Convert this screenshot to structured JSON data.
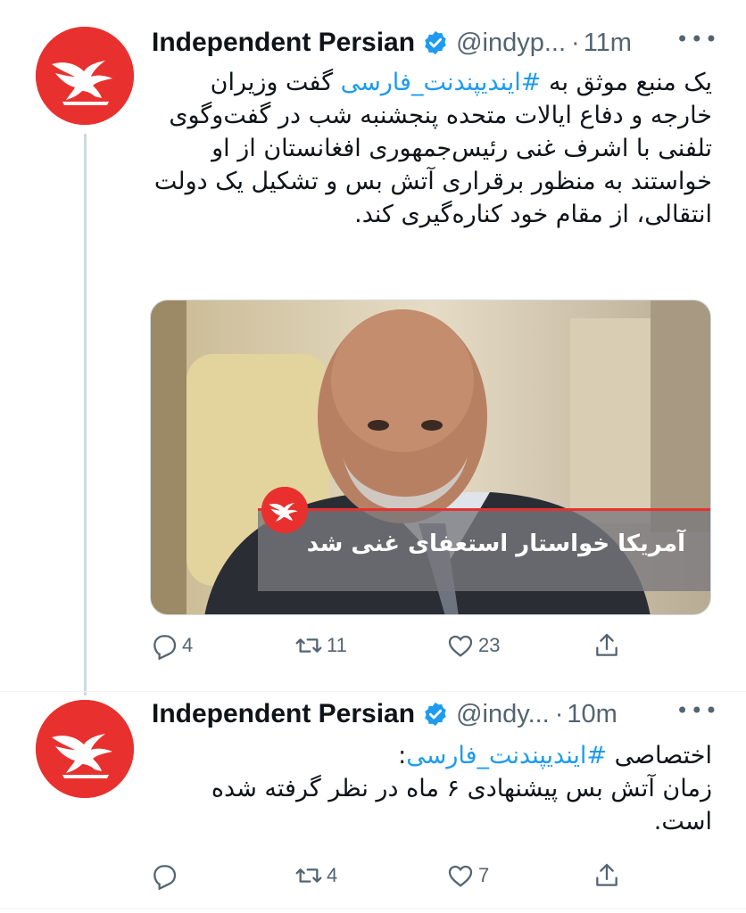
{
  "tweets": [
    {
      "author_name": "Independent Persian",
      "handle": "@indyp...",
      "separator": "·",
      "time": "11m",
      "body_prefix": "یک منبع موثق به ",
      "hashtag": "#ایندیپندنت_فارسی",
      "body_rest": " گفت وزیران خارجه و دفاع ایالات متحده پنجشنبه شب در گفت‌وگوی تلفنی با اشرف غنی رئیس‌جمهوری افغانستان از او خواستند به منظور برقراری آتش بس و تشکیل یک دولت انتقالی، از مقام خود کناره‌گیری کند.",
      "media_caption": "آمریکا خواستار استعفای غنی شد",
      "replies": "4",
      "retweets": "11",
      "likes": "23"
    },
    {
      "author_name": "Independent Persian",
      "handle": "@indy...",
      "separator": "·",
      "time": "10m",
      "body_prefix": "اختصاصی ",
      "hashtag": "#ایندیپندنت_فارسی",
      "body_suffix": ":",
      "body_rest": "زمان آتش بس پیشنهادی ۶ ماه در نظر گرفته شده است.",
      "replies": "",
      "retweets": "4",
      "likes": "7"
    }
  ],
  "icons": {
    "more": "more-icon",
    "verified": "verified-badge-icon",
    "reply": "reply-icon",
    "retweet": "retweet-icon",
    "like": "heart-icon",
    "share": "share-icon"
  },
  "colors": {
    "accent": "#1d9bf0",
    "brand": "#e8312f",
    "muted": "#536471",
    "text": "#0f1419"
  }
}
